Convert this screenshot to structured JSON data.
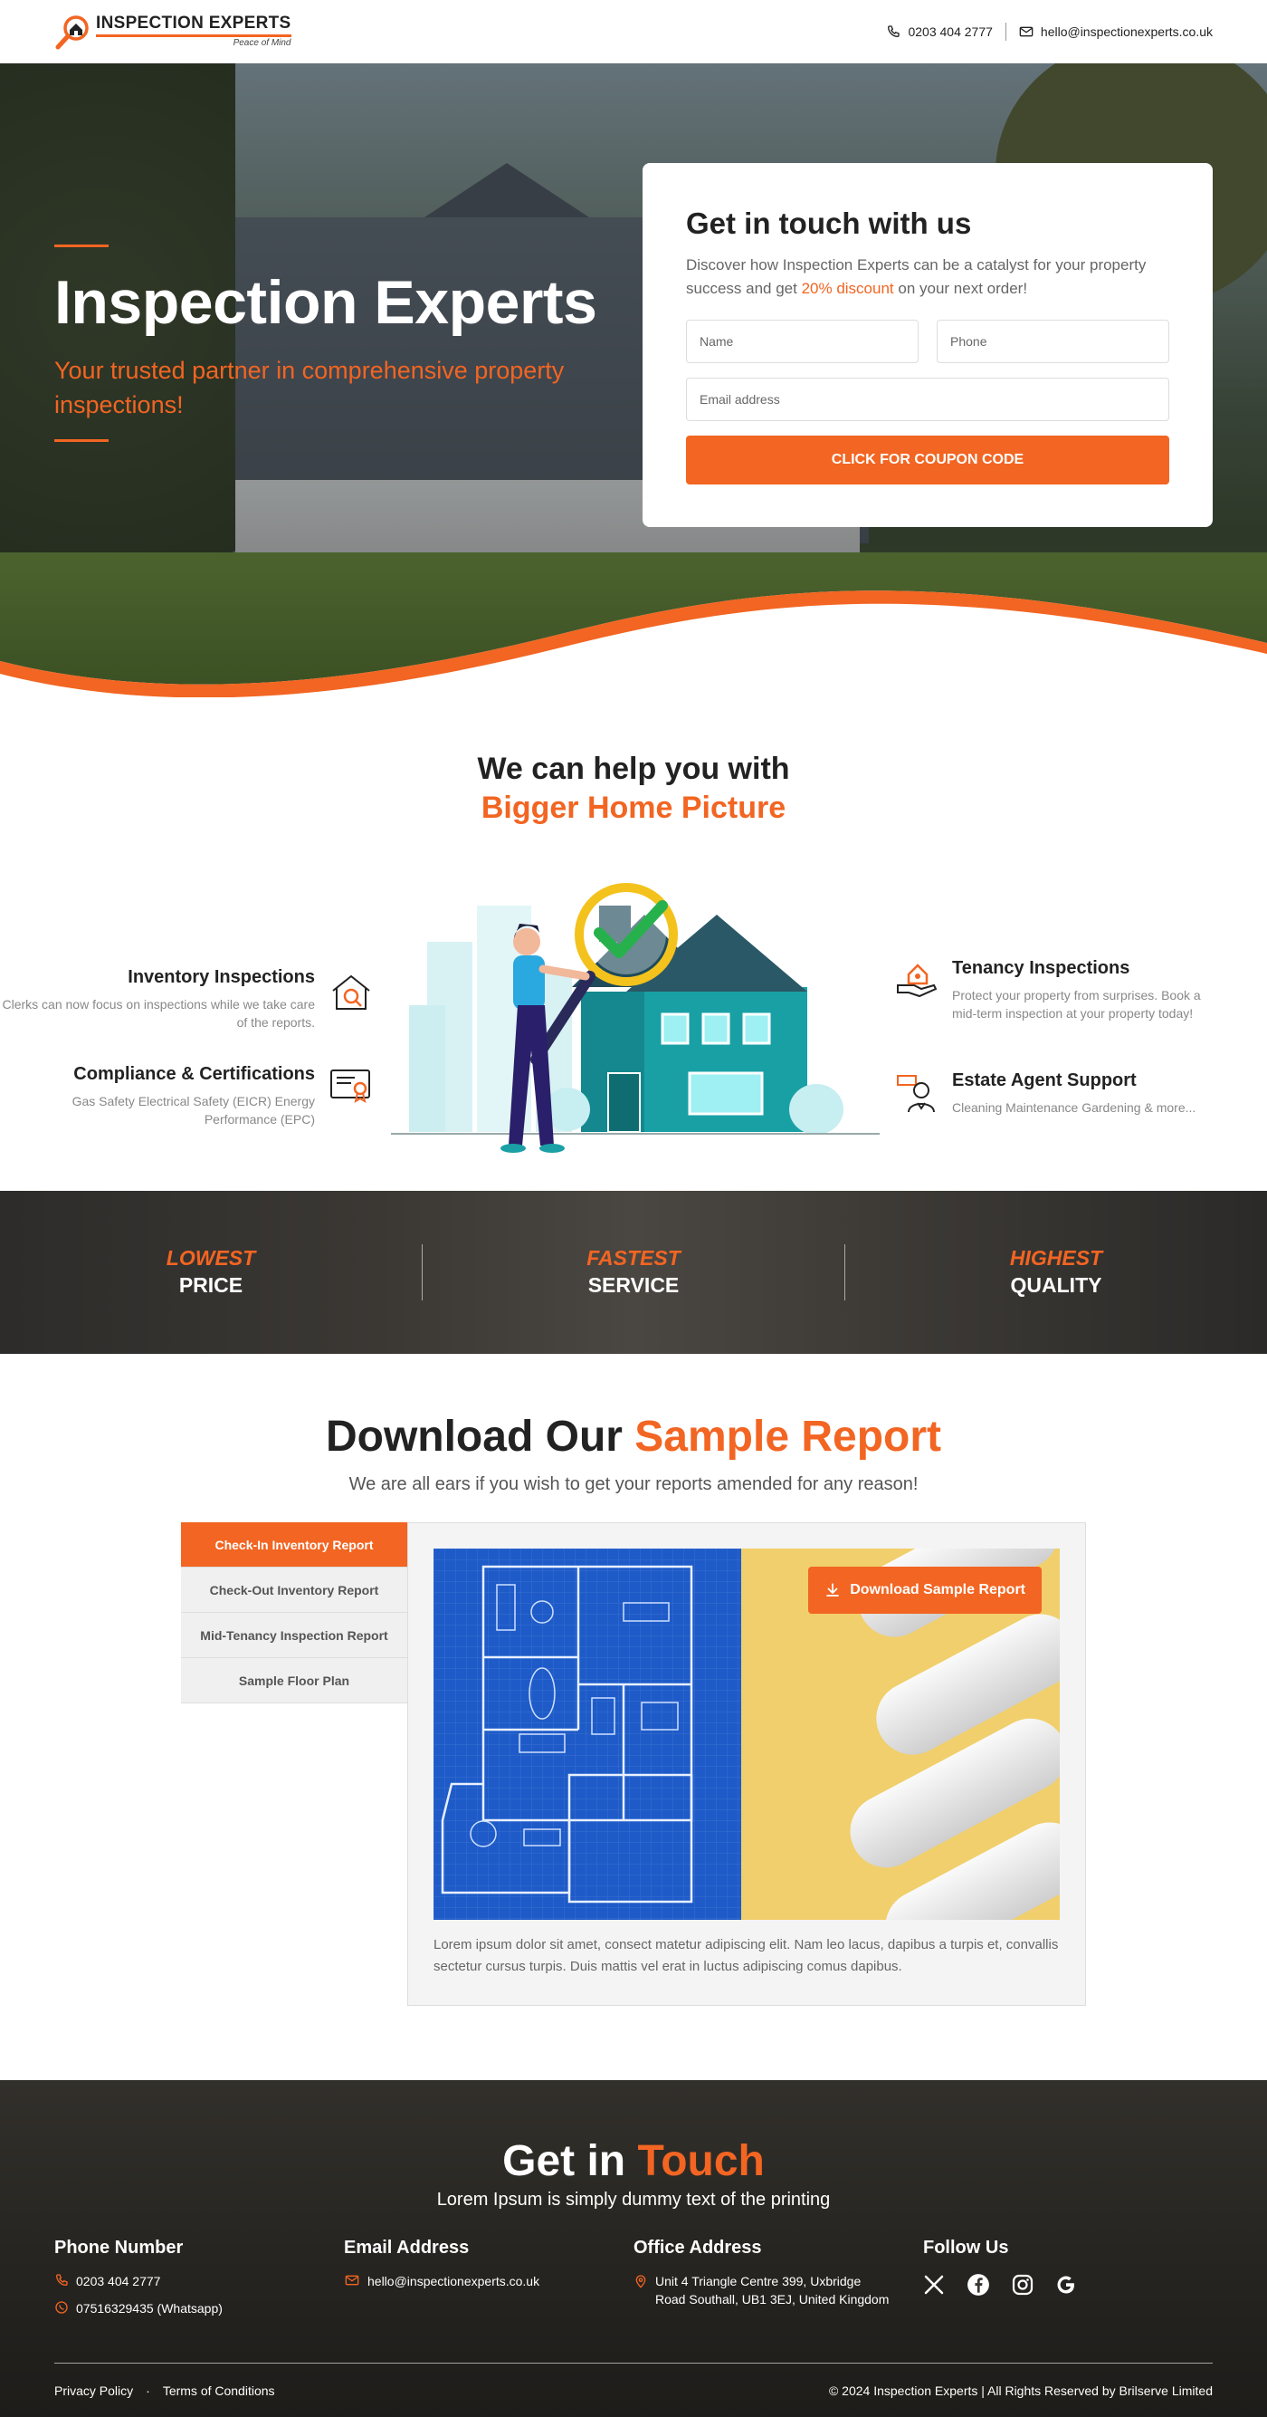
{
  "brand": {
    "name": "INSPECTION EXPERTS",
    "tagline": "Peace of Mind",
    "accent": "#f26522"
  },
  "header": {
    "phone": "0203 404 2777",
    "email": "hello@inspectionexperts.co.uk"
  },
  "hero": {
    "title": "Inspection Experts",
    "subtitle": "Your trusted partner in comprehensive property inspections!",
    "form": {
      "title": "Get in touch with us",
      "desc_pre": "Discover how Inspection Experts can be a catalyst for your property success and get ",
      "desc_highlight": "20% discount",
      "desc_post": " on your next order!",
      "name_placeholder": "Name",
      "phone_placeholder": "Phone",
      "email_placeholder": "Email address",
      "button": "CLICK FOR COUPON CODE"
    }
  },
  "help": {
    "title_line1": "We can help you with",
    "title_line2": "Bigger Home Picture",
    "services": [
      {
        "title": "Inventory Inspections",
        "desc": "Clerks can now focus on inspections while we take care of the reports.",
        "icon": "house-inspection-icon"
      },
      {
        "title": "Compliance & Certifications",
        "desc": "Gas Safety Electrical Safety (EICR) Energy Performance (EPC)",
        "icon": "certificate-icon"
      },
      {
        "title": "Tenancy Inspections",
        "desc": "Protect your property from surprises. Book a mid-term inspection at your property today!",
        "icon": "hand-house-icon"
      },
      {
        "title": "Estate Agent Support",
        "desc": "Cleaning Maintenance Gardening & more...",
        "icon": "agent-sold-icon"
      }
    ]
  },
  "banner": [
    {
      "top": "LOWEST",
      "bottom": "PRICE"
    },
    {
      "top": "FASTEST",
      "bottom": "SERVICE"
    },
    {
      "top": "HIGHEST",
      "bottom": "QUALITY"
    }
  ],
  "report": {
    "title_pre": "Download Our ",
    "title_highlight": "Sample Report",
    "subtitle": "We are all ears if you wish to get your reports amended for any reason!",
    "tabs": [
      "Check-In Inventory Report",
      "Check-Out Inventory Report",
      "Mid-Tenancy Inspection Report",
      "Sample Floor Plan"
    ],
    "active_tab": 0,
    "download_button": "Download Sample Report",
    "body": "Lorem ipsum dolor sit amet, consect matetur adipiscing elit. Nam leo lacus, dapibus a turpis et, convallis sectetur cursus turpis. Duis mattis vel erat in luctus adipiscing comus dapibus."
  },
  "contact": {
    "title_pre": "Get in ",
    "title_highlight": "Touch",
    "lead": "Lorem Ipsum is simply dummy text of the printing",
    "phone_heading": "Phone Number",
    "phone1": "0203 404 2777",
    "phone2": "07516329435 (Whatsapp)",
    "email_heading": "Email Address",
    "email": "hello@inspectionexperts.co.uk",
    "office_heading": "Office Address",
    "address_line1": "Unit 4 Triangle Centre 399, Uxbridge",
    "address_line2": "Road Southall, UB1 3EJ, United Kingdom",
    "follow_heading": "Follow Us",
    "social": [
      "x-icon",
      "facebook-icon",
      "instagram-icon",
      "google-icon"
    ]
  },
  "footer": {
    "privacy": "Privacy Policy",
    "terms": "Terms of Conditions",
    "dot": "·",
    "copyright": "© 2024 Inspection Experts | All Rights Reserved by Brilserve Limited"
  }
}
